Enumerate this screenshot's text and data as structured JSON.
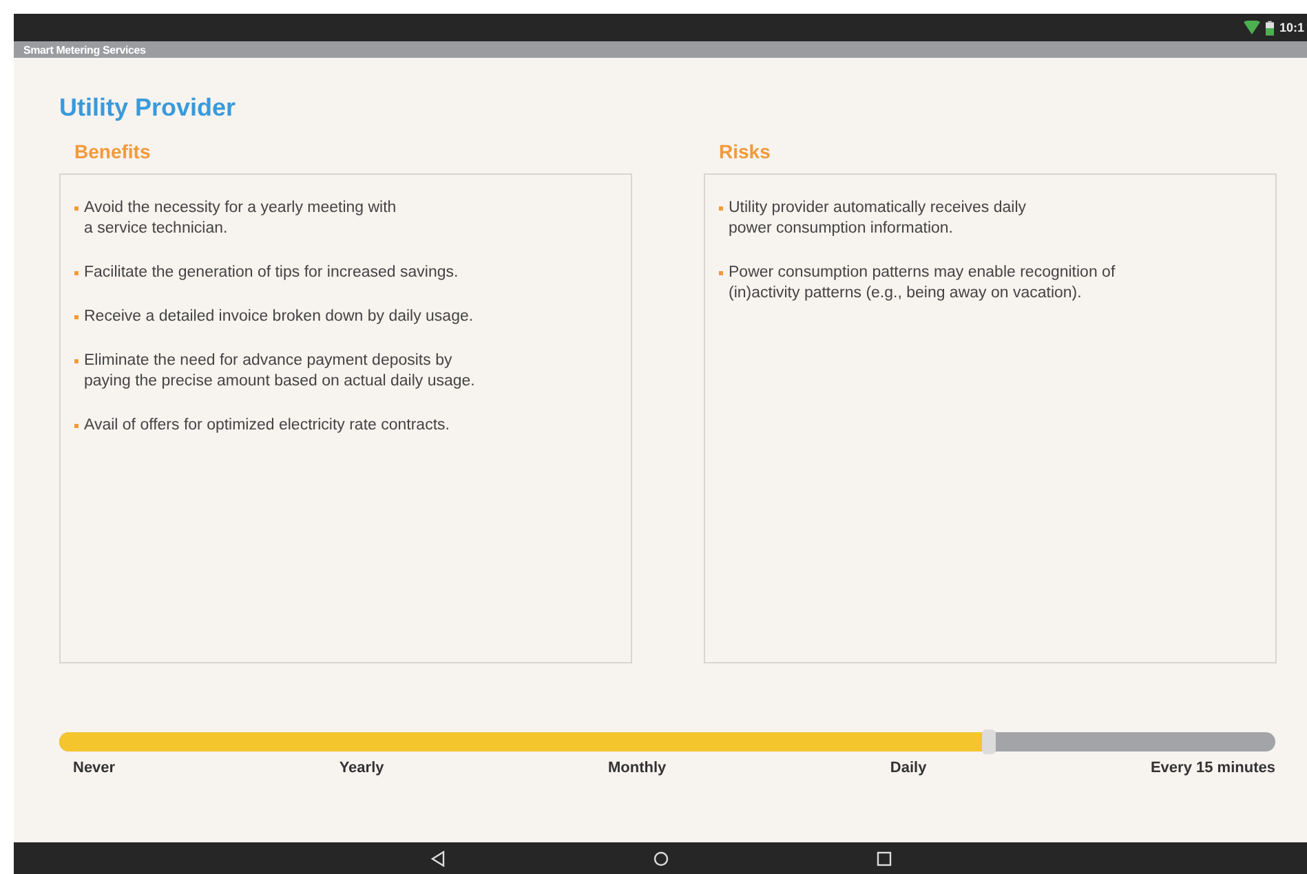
{
  "status_bar": {
    "time": "10:1"
  },
  "app_bar": {
    "title": "Smart Metering Services"
  },
  "page": {
    "title": "Utility Provider"
  },
  "panels": [
    {
      "heading": "Benefits",
      "items": [
        "Avoid the necessity for a yearly meeting with\na service technician.",
        "Facilitate the generation of tips for increased savings.",
        "Receive a detailed invoice broken down by daily usage.",
        "Eliminate the need for advance payment deposits by\npaying the precise amount based on actual daily usage.",
        "Avail of offers for optimized electricity rate contracts."
      ]
    },
    {
      "heading": "Risks",
      "items": [
        "Utility provider automatically receives daily\npower consumption information.",
        "Power consumption patterns may enable recognition of\n(in)activity patterns (e.g., being away on vacation)."
      ]
    }
  ],
  "slider": {
    "level": 0.765,
    "stops": [
      "Never",
      "Yearly",
      "Monthly",
      "Daily",
      "Every 15 minutes"
    ]
  }
}
